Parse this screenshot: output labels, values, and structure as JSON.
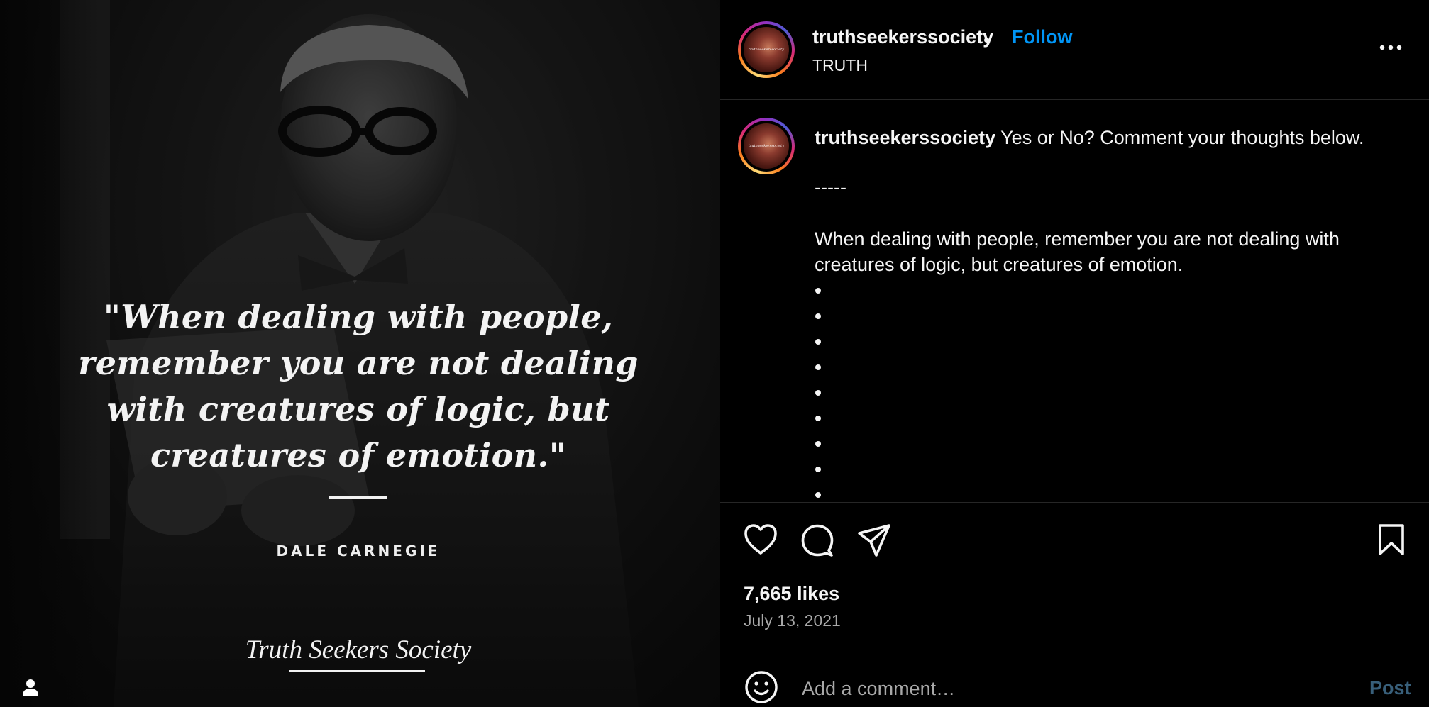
{
  "media": {
    "quote": "\"When dealing with people, remember you are not dealing with creatures of logic, but creatures of emotion.\"",
    "author": "DALE CARNEGIE",
    "brand": "Truth Seekers Society",
    "tag_icon": "user-tag-icon"
  },
  "header": {
    "username": "truthseekerssociety",
    "separator": "•",
    "follow_label": "Follow",
    "subtitle": "TRUTH",
    "more_icon": "more-options-icon",
    "avatar_text": "truthseekerssociety"
  },
  "caption": {
    "username": "truthseekerssociety",
    "text": "Yes or No? Comment your thoughts below.",
    "separator_line": "-----",
    "quote_line1": "When dealing with people, remember you are not dealing with",
    "quote_line2": "creatures of logic, but creatures of emotion.",
    "bullet_count": 9
  },
  "actions": {
    "like_icon": "heart-icon",
    "comment_icon": "comment-icon",
    "share_icon": "share-icon",
    "save_icon": "bookmark-icon"
  },
  "likes": "7,665 likes",
  "date": "July 13, 2021",
  "comment_box": {
    "emoji_icon": "emoji-icon",
    "placeholder": "Add a comment…",
    "post_label": "Post"
  },
  "colors": {
    "accent": "#0095f6",
    "post_disabled": "#385f7a",
    "muted": "#a8a8a8",
    "divider": "#262626"
  }
}
